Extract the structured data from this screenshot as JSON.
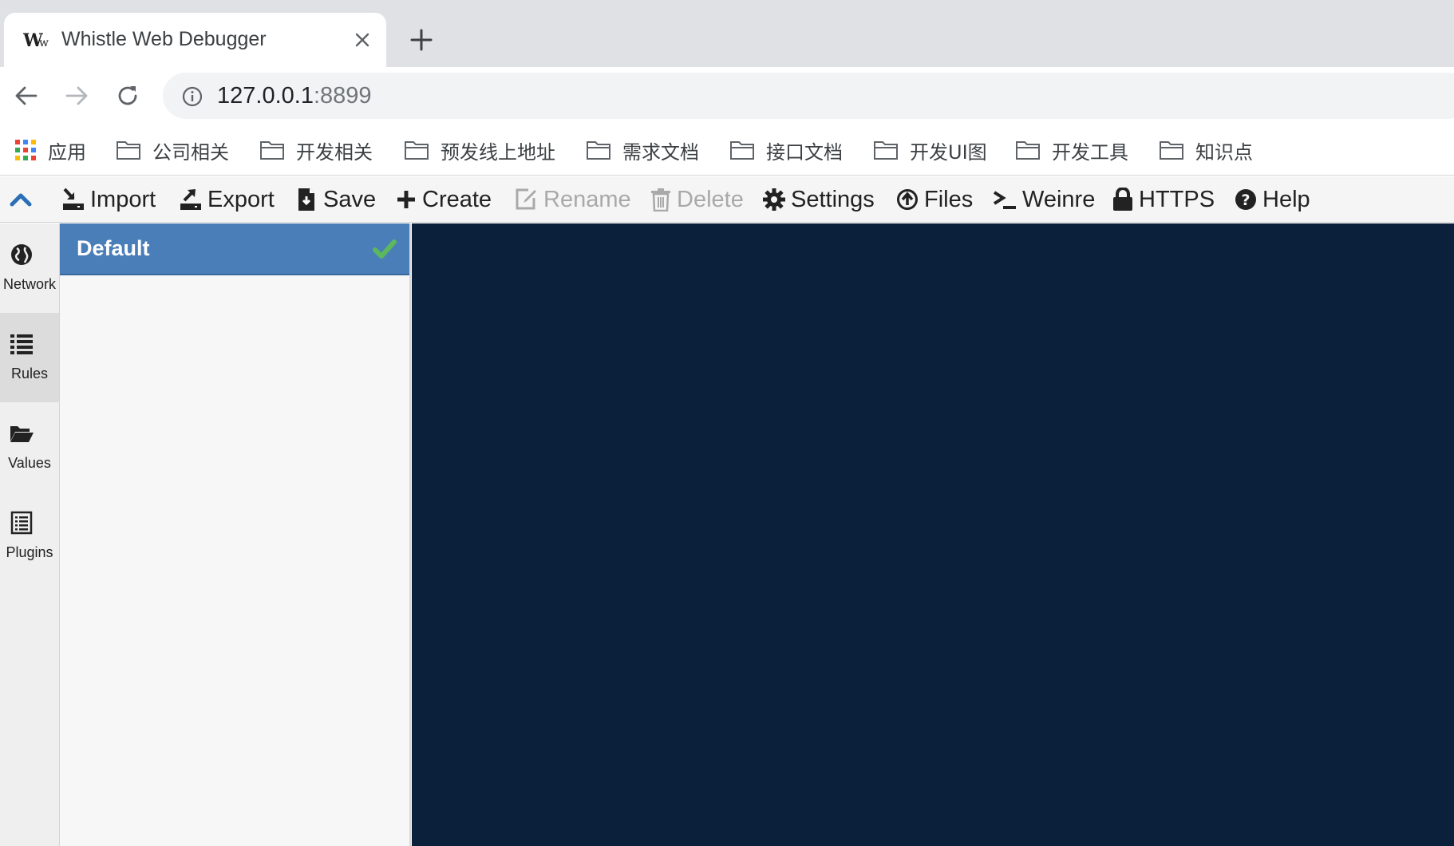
{
  "browser": {
    "tab": {
      "title": "Whistle Web Debugger"
    },
    "address": {
      "host": "127.0.0.1",
      "port": ":8899"
    },
    "bookmarks": [
      {
        "label": "应用",
        "icon": "apps-grid-icon"
      },
      {
        "label": "公司相关",
        "icon": "folder-icon"
      },
      {
        "label": "开发相关",
        "icon": "folder-icon"
      },
      {
        "label": "预发线上地址",
        "icon": "folder-icon"
      },
      {
        "label": "需求文档",
        "icon": "folder-icon"
      },
      {
        "label": "接口文档",
        "icon": "folder-icon"
      },
      {
        "label": "开发UI图",
        "icon": "folder-icon"
      },
      {
        "label": "开发工具",
        "icon": "folder-icon"
      },
      {
        "label": "知识点",
        "icon": "folder-icon"
      }
    ]
  },
  "menubar": {
    "items": [
      {
        "label": "Import",
        "icon": "import-icon",
        "enabled": true
      },
      {
        "label": "Export",
        "icon": "export-icon",
        "enabled": true
      },
      {
        "label": "Save",
        "icon": "save-icon",
        "enabled": true
      },
      {
        "label": "Create",
        "icon": "plus-icon",
        "enabled": true
      },
      {
        "label": "Rename",
        "icon": "edit-icon",
        "enabled": false
      },
      {
        "label": "Delete",
        "icon": "trash-icon",
        "enabled": false
      },
      {
        "label": "Settings",
        "icon": "gear-icon",
        "enabled": true
      },
      {
        "label": "Files",
        "icon": "upload-circle-icon",
        "enabled": true
      },
      {
        "label": "Weinre",
        "icon": "terminal-icon",
        "enabled": true
      },
      {
        "label": "HTTPS",
        "icon": "lock-icon",
        "enabled": true
      },
      {
        "label": "Help",
        "icon": "question-circle-icon",
        "enabled": true
      }
    ]
  },
  "leftnav": {
    "items": [
      {
        "label": "Network",
        "icon": "globe-icon",
        "active": false
      },
      {
        "label": "Rules",
        "icon": "list-icon",
        "active": true
      },
      {
        "label": "Values",
        "icon": "folder-open-icon",
        "active": false
      },
      {
        "label": "Plugins",
        "icon": "plugin-list-icon",
        "active": false
      }
    ]
  },
  "rules": {
    "items": [
      {
        "name": "Default",
        "selected": true,
        "enabled": true
      }
    ]
  },
  "colors": {
    "tabstrip": "#dfe1e5",
    "rule_selected": "#4a7eb8",
    "check": "#5cb85c",
    "editor_background": "#0b203a",
    "menu_disabled": "#a9a9a9"
  }
}
